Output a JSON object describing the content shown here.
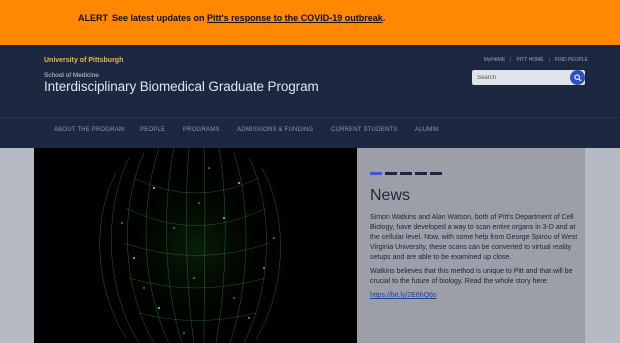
{
  "alert": {
    "label": "ALERT",
    "text_prefix": "See latest updates on ",
    "link_text": "Pitt's response to the COVID-19 outbreak",
    "text_suffix": "."
  },
  "header": {
    "university": "University of Pittsburgh",
    "school": "School of Medicine",
    "program_title": "Interdisciplinary Biomedical Graduate Program",
    "util_links": [
      "MyPittME",
      "PITT HOME",
      "FIND PEOPLE"
    ],
    "search_placeholder": "Search"
  },
  "nav": {
    "items": [
      "ABOUT THE PROGRAM",
      "PEOPLE",
      "PROGRAMS",
      "ADMISSIONS & FUNDING",
      "CURRENT STUDENTS",
      "ALUMNI"
    ]
  },
  "news": {
    "title": "News",
    "paragraph1": "Simon Watkins and Alan Watson, both of Pitt's Department of Cell Biology, have developed a way to scan entire organs in 3-D and at the cellular level. Now, with some help from George Spirou of West Virginia University, these scans can be converted to virtual reality setups and are able to be examined up close.",
    "paragraph2": "Watkins believes that this method is unique to Pitt and that will be crucial to the future of biology. Read the whole story here:",
    "link": "https://bit.ly/2E6hQ6s",
    "slide_count": 5,
    "active_slide": 1
  },
  "colors": {
    "alert_bg": "#ff8800",
    "header_bg": "#1c2740",
    "gold": "#e8b84a",
    "search_btn": "#2a52c4"
  }
}
